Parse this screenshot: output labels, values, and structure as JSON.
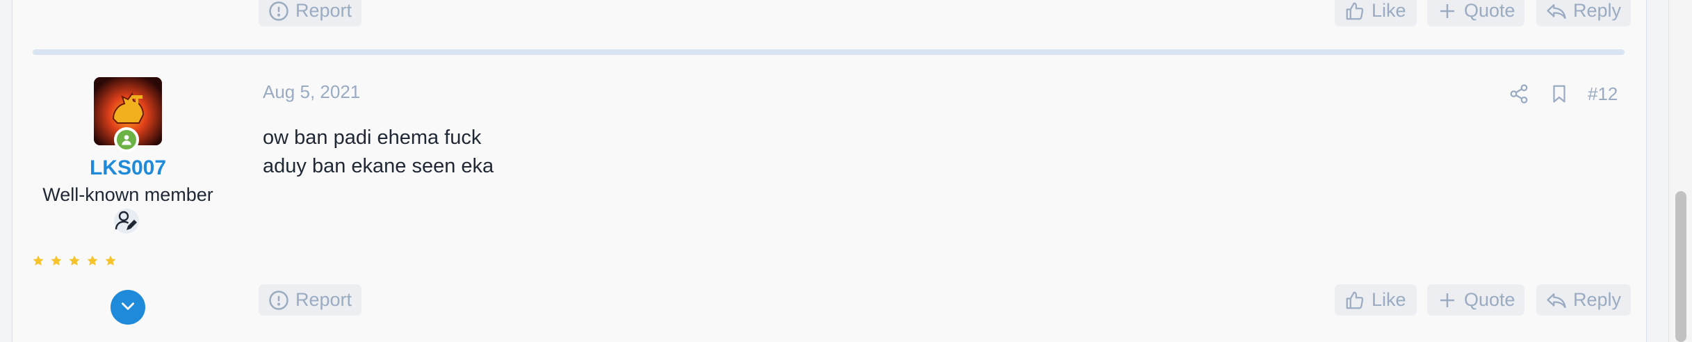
{
  "previous_post_footer": {
    "report_label": "Report",
    "like_label": "Like",
    "quote_label": "Quote",
    "reply_label": "Reply"
  },
  "post": {
    "author": {
      "username": "LKS007",
      "title": "Well-known member",
      "rating_stars": 5
    },
    "date": "Aug 5, 2021",
    "number": "#12",
    "body_lines": [
      "ow ban padi ehema fuck",
      "aduy ban ekane seen eka"
    ],
    "footer": {
      "report_label": "Report",
      "like_label": "Like",
      "quote_label": "Quote",
      "reply_label": "Reply"
    }
  },
  "icons": {
    "report": "alert-circle-icon",
    "like": "thumbs-up-icon",
    "quote": "plus-icon",
    "reply": "reply-arrow-icon",
    "share": "share-icon",
    "bookmark": "bookmark-icon",
    "online": "online-user-icon",
    "user_badge": "user-edit-icon",
    "star": "star-icon",
    "expand": "chevron-down-icon"
  },
  "colors": {
    "accent": "#1f8ad9",
    "muted_text": "#9aabc2",
    "body_text": "#1e2733",
    "online": "#6cb244",
    "star": "#f6c32b",
    "button_bg": "#eceef1"
  }
}
